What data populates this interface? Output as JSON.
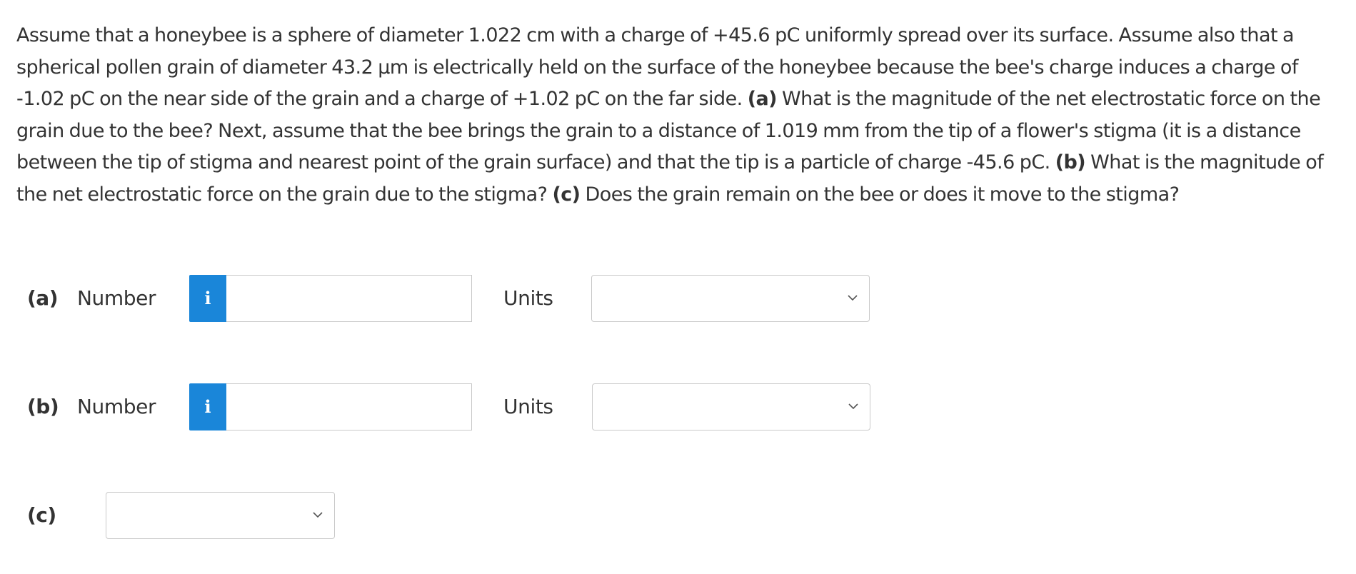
{
  "question": {
    "intro": "Assume that a honeybee is a sphere of diameter 1.022 cm with a charge of +45.6 pC uniformly spread over its surface. Assume also that a spherical pollen grain of diameter 43.2 μm is electrically held on the surface of the honeybee because the bee's charge induces a charge of -1.02 pC on the near side of the grain and a charge of +1.02 pC on the far side.",
    "a_marker": "(a)",
    "a_text": "What is the magnitude of the net electrostatic force on the grain due to the bee? Next, assume that the bee brings the grain to a distance of 1.019 mm from the tip of a flower's stigma (it is a distance between the tip of stigma and nearest point of the grain surface) and that the tip is a particle of charge -45.6 pC.",
    "b_marker": "(b)",
    "b_text": "What is the magnitude of the net electrostatic force on the grain due to the stigma?",
    "c_marker": "(c)",
    "c_text": "Does the grain remain on the bee or does it move to the stigma?"
  },
  "parts": {
    "a": {
      "label": "(a)",
      "number_label": "Number",
      "info_icon": "i",
      "number_value": "",
      "units_label": "Units",
      "units_selected": ""
    },
    "b": {
      "label": "(b)",
      "number_label": "Number",
      "info_icon": "i",
      "number_value": "",
      "units_label": "Units",
      "units_selected": ""
    },
    "c": {
      "label": "(c)",
      "selected": ""
    }
  },
  "colors": {
    "info_button": "#1a86d9",
    "text": "#333333",
    "border": "#c9c9c9"
  }
}
